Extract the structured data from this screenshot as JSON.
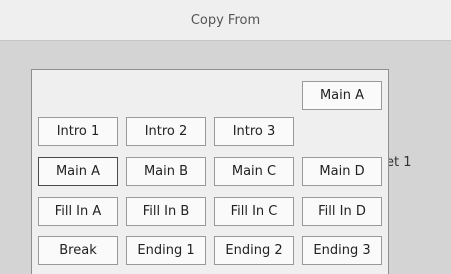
{
  "header": {
    "title": "Copy From"
  },
  "background": {
    "partial_text": "et 1"
  },
  "popup": {
    "top_button": "Main A",
    "rows": [
      [
        "Intro 1",
        "Intro 2",
        "Intro 3"
      ],
      [
        "Main A",
        "Main B",
        "Main C",
        "Main D"
      ],
      [
        "Fill In A",
        "Fill In B",
        "Fill In C",
        "Fill In D"
      ],
      [
        "Break",
        "Ending 1",
        "Ending 2",
        "Ending 3"
      ]
    ]
  }
}
